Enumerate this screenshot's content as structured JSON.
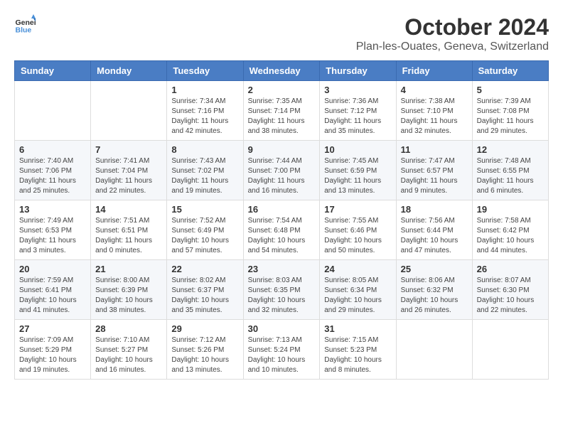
{
  "header": {
    "logo_line1": "General",
    "logo_line2": "Blue",
    "title": "October 2024",
    "subtitle": "Plan-les-Ouates, Geneva, Switzerland"
  },
  "weekdays": [
    "Sunday",
    "Monday",
    "Tuesday",
    "Wednesday",
    "Thursday",
    "Friday",
    "Saturday"
  ],
  "weeks": [
    [
      {
        "day": "",
        "sunrise": "",
        "sunset": "",
        "daylight": ""
      },
      {
        "day": "",
        "sunrise": "",
        "sunset": "",
        "daylight": ""
      },
      {
        "day": "1",
        "sunrise": "Sunrise: 7:34 AM",
        "sunset": "Sunset: 7:16 PM",
        "daylight": "Daylight: 11 hours and 42 minutes."
      },
      {
        "day": "2",
        "sunrise": "Sunrise: 7:35 AM",
        "sunset": "Sunset: 7:14 PM",
        "daylight": "Daylight: 11 hours and 38 minutes."
      },
      {
        "day": "3",
        "sunrise": "Sunrise: 7:36 AM",
        "sunset": "Sunset: 7:12 PM",
        "daylight": "Daylight: 11 hours and 35 minutes."
      },
      {
        "day": "4",
        "sunrise": "Sunrise: 7:38 AM",
        "sunset": "Sunset: 7:10 PM",
        "daylight": "Daylight: 11 hours and 32 minutes."
      },
      {
        "day": "5",
        "sunrise": "Sunrise: 7:39 AM",
        "sunset": "Sunset: 7:08 PM",
        "daylight": "Daylight: 11 hours and 29 minutes."
      }
    ],
    [
      {
        "day": "6",
        "sunrise": "Sunrise: 7:40 AM",
        "sunset": "Sunset: 7:06 PM",
        "daylight": "Daylight: 11 hours and 25 minutes."
      },
      {
        "day": "7",
        "sunrise": "Sunrise: 7:41 AM",
        "sunset": "Sunset: 7:04 PM",
        "daylight": "Daylight: 11 hours and 22 minutes."
      },
      {
        "day": "8",
        "sunrise": "Sunrise: 7:43 AM",
        "sunset": "Sunset: 7:02 PM",
        "daylight": "Daylight: 11 hours and 19 minutes."
      },
      {
        "day": "9",
        "sunrise": "Sunrise: 7:44 AM",
        "sunset": "Sunset: 7:00 PM",
        "daylight": "Daylight: 11 hours and 16 minutes."
      },
      {
        "day": "10",
        "sunrise": "Sunrise: 7:45 AM",
        "sunset": "Sunset: 6:59 PM",
        "daylight": "Daylight: 11 hours and 13 minutes."
      },
      {
        "day": "11",
        "sunrise": "Sunrise: 7:47 AM",
        "sunset": "Sunset: 6:57 PM",
        "daylight": "Daylight: 11 hours and 9 minutes."
      },
      {
        "day": "12",
        "sunrise": "Sunrise: 7:48 AM",
        "sunset": "Sunset: 6:55 PM",
        "daylight": "Daylight: 11 hours and 6 minutes."
      }
    ],
    [
      {
        "day": "13",
        "sunrise": "Sunrise: 7:49 AM",
        "sunset": "Sunset: 6:53 PM",
        "daylight": "Daylight: 11 hours and 3 minutes."
      },
      {
        "day": "14",
        "sunrise": "Sunrise: 7:51 AM",
        "sunset": "Sunset: 6:51 PM",
        "daylight": "Daylight: 11 hours and 0 minutes."
      },
      {
        "day": "15",
        "sunrise": "Sunrise: 7:52 AM",
        "sunset": "Sunset: 6:49 PM",
        "daylight": "Daylight: 10 hours and 57 minutes."
      },
      {
        "day": "16",
        "sunrise": "Sunrise: 7:54 AM",
        "sunset": "Sunset: 6:48 PM",
        "daylight": "Daylight: 10 hours and 54 minutes."
      },
      {
        "day": "17",
        "sunrise": "Sunrise: 7:55 AM",
        "sunset": "Sunset: 6:46 PM",
        "daylight": "Daylight: 10 hours and 50 minutes."
      },
      {
        "day": "18",
        "sunrise": "Sunrise: 7:56 AM",
        "sunset": "Sunset: 6:44 PM",
        "daylight": "Daylight: 10 hours and 47 minutes."
      },
      {
        "day": "19",
        "sunrise": "Sunrise: 7:58 AM",
        "sunset": "Sunset: 6:42 PM",
        "daylight": "Daylight: 10 hours and 44 minutes."
      }
    ],
    [
      {
        "day": "20",
        "sunrise": "Sunrise: 7:59 AM",
        "sunset": "Sunset: 6:41 PM",
        "daylight": "Daylight: 10 hours and 41 minutes."
      },
      {
        "day": "21",
        "sunrise": "Sunrise: 8:00 AM",
        "sunset": "Sunset: 6:39 PM",
        "daylight": "Daylight: 10 hours and 38 minutes."
      },
      {
        "day": "22",
        "sunrise": "Sunrise: 8:02 AM",
        "sunset": "Sunset: 6:37 PM",
        "daylight": "Daylight: 10 hours and 35 minutes."
      },
      {
        "day": "23",
        "sunrise": "Sunrise: 8:03 AM",
        "sunset": "Sunset: 6:35 PM",
        "daylight": "Daylight: 10 hours and 32 minutes."
      },
      {
        "day": "24",
        "sunrise": "Sunrise: 8:05 AM",
        "sunset": "Sunset: 6:34 PM",
        "daylight": "Daylight: 10 hours and 29 minutes."
      },
      {
        "day": "25",
        "sunrise": "Sunrise: 8:06 AM",
        "sunset": "Sunset: 6:32 PM",
        "daylight": "Daylight: 10 hours and 26 minutes."
      },
      {
        "day": "26",
        "sunrise": "Sunrise: 8:07 AM",
        "sunset": "Sunset: 6:30 PM",
        "daylight": "Daylight: 10 hours and 22 minutes."
      }
    ],
    [
      {
        "day": "27",
        "sunrise": "Sunrise: 7:09 AM",
        "sunset": "Sunset: 5:29 PM",
        "daylight": "Daylight: 10 hours and 19 minutes."
      },
      {
        "day": "28",
        "sunrise": "Sunrise: 7:10 AM",
        "sunset": "Sunset: 5:27 PM",
        "daylight": "Daylight: 10 hours and 16 minutes."
      },
      {
        "day": "29",
        "sunrise": "Sunrise: 7:12 AM",
        "sunset": "Sunset: 5:26 PM",
        "daylight": "Daylight: 10 hours and 13 minutes."
      },
      {
        "day": "30",
        "sunrise": "Sunrise: 7:13 AM",
        "sunset": "Sunset: 5:24 PM",
        "daylight": "Daylight: 10 hours and 10 minutes."
      },
      {
        "day": "31",
        "sunrise": "Sunrise: 7:15 AM",
        "sunset": "Sunset: 5:23 PM",
        "daylight": "Daylight: 10 hours and 8 minutes."
      },
      {
        "day": "",
        "sunrise": "",
        "sunset": "",
        "daylight": ""
      },
      {
        "day": "",
        "sunrise": "",
        "sunset": "",
        "daylight": ""
      }
    ]
  ]
}
